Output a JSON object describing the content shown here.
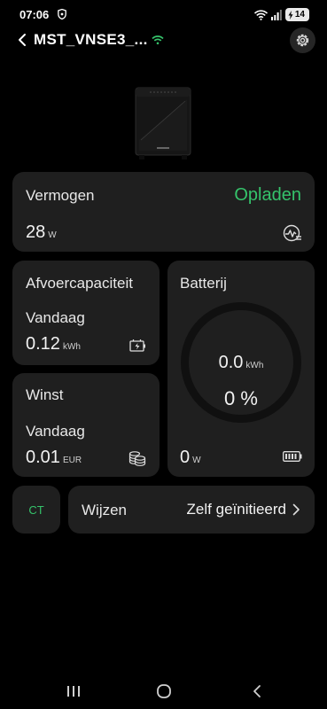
{
  "status_bar": {
    "time": "07:06",
    "battery_level": "14"
  },
  "header": {
    "title": "MST_VNSE3_..."
  },
  "power": {
    "label": "Vermogen",
    "state": "Opladen",
    "value": "28",
    "unit": "W"
  },
  "discharge": {
    "title": "Afvoercapaciteit",
    "period": "Vandaag",
    "value": "0.12",
    "unit": "kWh"
  },
  "profit": {
    "title": "Winst",
    "period": "Vandaag",
    "value": "0.01",
    "unit": "EUR"
  },
  "battery": {
    "title": "Batterij",
    "energy_value": "0.0",
    "energy_unit": "kWh",
    "percent": "0 %",
    "power_value": "0",
    "power_unit": "W"
  },
  "ct": {
    "label": "CT"
  },
  "mode": {
    "label": "Wijzen",
    "value": "Zelf geïnitieerd"
  },
  "colors": {
    "accent_green": "#35c36b",
    "card_bg": "#1f1f1f",
    "background": "#000000"
  },
  "icons": [
    "shield-icon",
    "wifi-icon",
    "signal-icon",
    "battery-icon",
    "back-arrow-icon",
    "settings-gear-icon",
    "power-chart-icon",
    "discharge-battery-icon",
    "coins-icon",
    "battery-level-icon",
    "chevron-right-icon",
    "recents-icon",
    "home-icon",
    "back-icon"
  ]
}
